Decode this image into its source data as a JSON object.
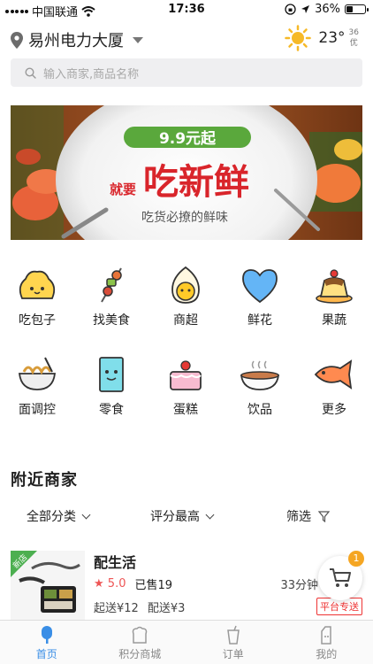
{
  "status_bar": {
    "carrier": "中国联通",
    "time": "17:36",
    "battery": "36%",
    "battery_level": 0.36
  },
  "header": {
    "location": "易州电力大厦",
    "weather": {
      "icon": "sun-icon",
      "temperature": "23°",
      "aqi_value": "36",
      "aqi_label": "优"
    }
  },
  "search": {
    "placeholder": "输入商家,商品名称"
  },
  "banner": {
    "badge": "9.9元起",
    "prefix": "就要",
    "headline": "吃新鲜",
    "tagline": "吃货必撩的鲜味"
  },
  "categories": [
    {
      "label": "吃包子",
      "icon": "bun-icon"
    },
    {
      "label": "找美食",
      "icon": "skewer-icon"
    },
    {
      "label": "商超",
      "icon": "egg-icon"
    },
    {
      "label": "鲜花",
      "icon": "heart-icon"
    },
    {
      "label": "果蔬",
      "icon": "pudding-icon"
    },
    {
      "label": "面调控",
      "icon": "noodles-icon"
    },
    {
      "label": "零食",
      "icon": "snack-bag-icon"
    },
    {
      "label": "蛋糕",
      "icon": "cake-icon"
    },
    {
      "label": "饮品",
      "icon": "soup-bowl-icon"
    },
    {
      "label": "更多",
      "icon": "fish-icon"
    }
  ],
  "nearby": {
    "title": "附近商家",
    "filters": {
      "category": "全部分类",
      "sort": "评分最高",
      "filter": "筛选"
    },
    "shops": [
      {
        "name": "配生活",
        "badge": "新店",
        "rating": "5.0",
        "sold": "已售19",
        "delivery_time": "33分钟",
        "min_order": "起送¥12",
        "delivery_fee": "配送¥3",
        "tag": "平台专送"
      }
    ]
  },
  "cart": {
    "count": "1"
  },
  "tabbar": {
    "items": [
      {
        "label": "首页",
        "icon": "popsicle-icon",
        "active": true
      },
      {
        "label": "积分商城",
        "icon": "bread-icon",
        "active": false
      },
      {
        "label": "订单",
        "icon": "cup-icon",
        "active": false
      },
      {
        "label": "我的",
        "icon": "milk-carton-icon",
        "active": false
      }
    ]
  },
  "colors": {
    "active_tab": "#3a8ee6",
    "rating": "#e55555",
    "tag": "#e33333",
    "cart_badge": "#f5a623",
    "banner_badge": "#5aa83c",
    "banner_headline": "#d9252b"
  }
}
